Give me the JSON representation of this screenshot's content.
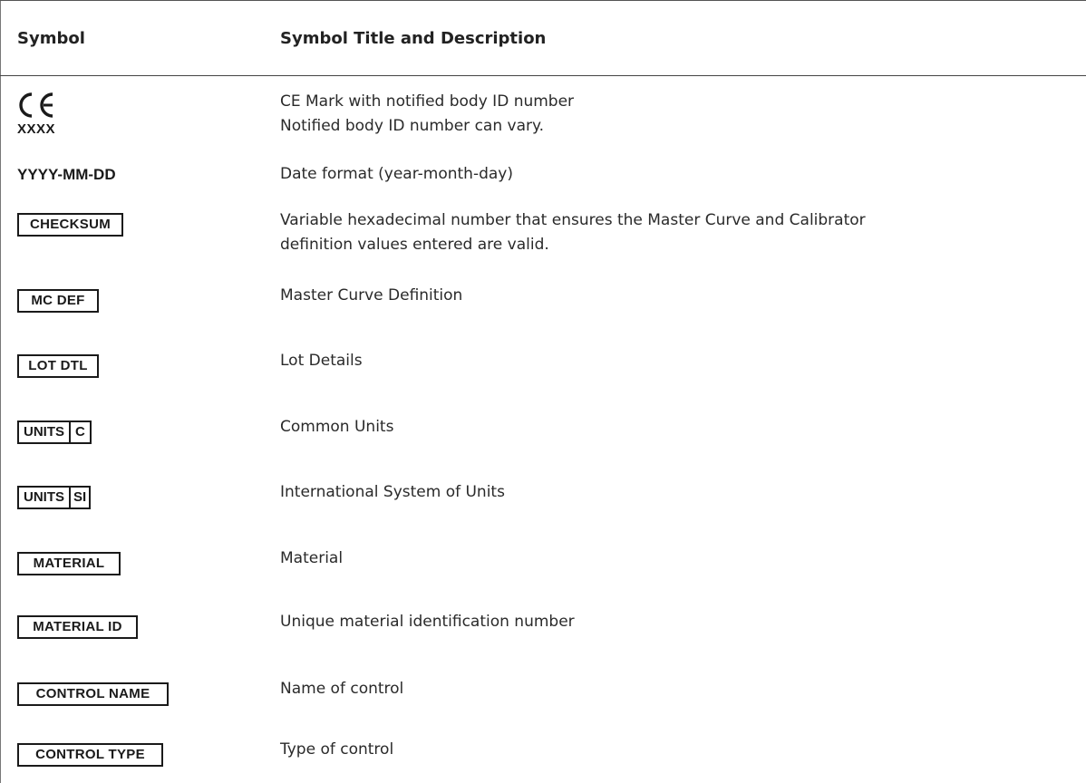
{
  "table": {
    "header": {
      "symbol": "Symbol",
      "description": "Symbol Title and Description"
    },
    "rows": [
      {
        "symbol_number": "XXXX",
        "line1": "CE Mark with notified body ID number",
        "line2": "Notified body ID number can vary."
      },
      {
        "symbol": "YYYY-MM-DD",
        "line1": "Date format (year-month-day)"
      },
      {
        "symbol": "CHECKSUM",
        "line1": "Variable hexadecimal number that ensures the Master Curve and Calibrator",
        "line2": "definition values entered are valid."
      },
      {
        "symbol": "MC DEF",
        "line1": "Master Curve Definition"
      },
      {
        "symbol": "LOT DTL",
        "line1": "Lot Details"
      },
      {
        "symbol_left": "UNITS",
        "symbol_right": "C",
        "line1": "Common Units"
      },
      {
        "symbol_left": "UNITS",
        "symbol_right": "SI",
        "line1": "International System of Units"
      },
      {
        "symbol": "MATERIAL",
        "line1": "Material"
      },
      {
        "symbol": "MATERIAL ID",
        "line1": "Unique material identification number"
      },
      {
        "symbol": "CONTROL NAME",
        "line1": "Name of control"
      },
      {
        "symbol": "CONTROL TYPE",
        "line1": "Type of control"
      }
    ]
  }
}
